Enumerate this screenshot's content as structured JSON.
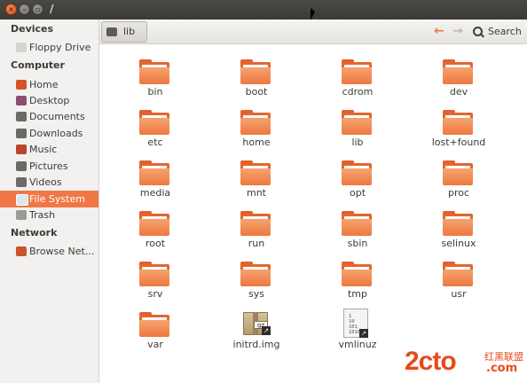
{
  "window": {
    "title": "/"
  },
  "sidebar": {
    "sections": [
      {
        "label": "Devices",
        "items": [
          {
            "label": "Floppy Drive",
            "icon": "floppy-icon"
          }
        ]
      },
      {
        "label": "Computer",
        "items": [
          {
            "label": "Home",
            "icon": "home-folder-icon"
          },
          {
            "label": "Desktop",
            "icon": "desktop-icon"
          },
          {
            "label": "Documents",
            "icon": "documents-icon"
          },
          {
            "label": "Downloads",
            "icon": "downloads-icon"
          },
          {
            "label": "Music",
            "icon": "music-icon"
          },
          {
            "label": "Pictures",
            "icon": "pictures-icon"
          },
          {
            "label": "Videos",
            "icon": "videos-icon"
          },
          {
            "label": "File System",
            "icon": "drive-icon",
            "selected": true
          },
          {
            "label": "Trash",
            "icon": "trash-icon"
          }
        ]
      },
      {
        "label": "Network",
        "items": [
          {
            "label": "Browse Net...",
            "icon": "network-icon"
          }
        ]
      }
    ]
  },
  "toolbar": {
    "breadcrumb": "lib",
    "back_icon": "arrow-left-icon",
    "forward_icon": "arrow-right-icon",
    "search_label": "Search"
  },
  "files": [
    {
      "name": "bin",
      "type": "folder"
    },
    {
      "name": "boot",
      "type": "folder"
    },
    {
      "name": "cdrom",
      "type": "folder"
    },
    {
      "name": "dev",
      "type": "folder"
    },
    {
      "name": "etc",
      "type": "folder"
    },
    {
      "name": "home",
      "type": "folder"
    },
    {
      "name": "lib",
      "type": "folder"
    },
    {
      "name": "lost+found",
      "type": "folder"
    },
    {
      "name": "media",
      "type": "folder"
    },
    {
      "name": "mnt",
      "type": "folder"
    },
    {
      "name": "opt",
      "type": "folder"
    },
    {
      "name": "proc",
      "type": "folder"
    },
    {
      "name": "root",
      "type": "folder"
    },
    {
      "name": "run",
      "type": "folder"
    },
    {
      "name": "sbin",
      "type": "folder"
    },
    {
      "name": "selinux",
      "type": "folder"
    },
    {
      "name": "srv",
      "type": "folder"
    },
    {
      "name": "sys",
      "type": "folder"
    },
    {
      "name": "tmp",
      "type": "folder"
    },
    {
      "name": "usr",
      "type": "folder"
    },
    {
      "name": "var",
      "type": "folder"
    },
    {
      "name": "initrd.img",
      "type": "archive-link",
      "badge": "gz"
    },
    {
      "name": "vmlinuz",
      "type": "binary-link",
      "content": "1\n10\n101\n1010"
    }
  ],
  "watermark": {
    "main": "2cto",
    "sub1": "红黑联盟",
    "sub2": ".com"
  },
  "colors": {
    "accent": "#f07746",
    "titlebar": "#3b3a36"
  }
}
